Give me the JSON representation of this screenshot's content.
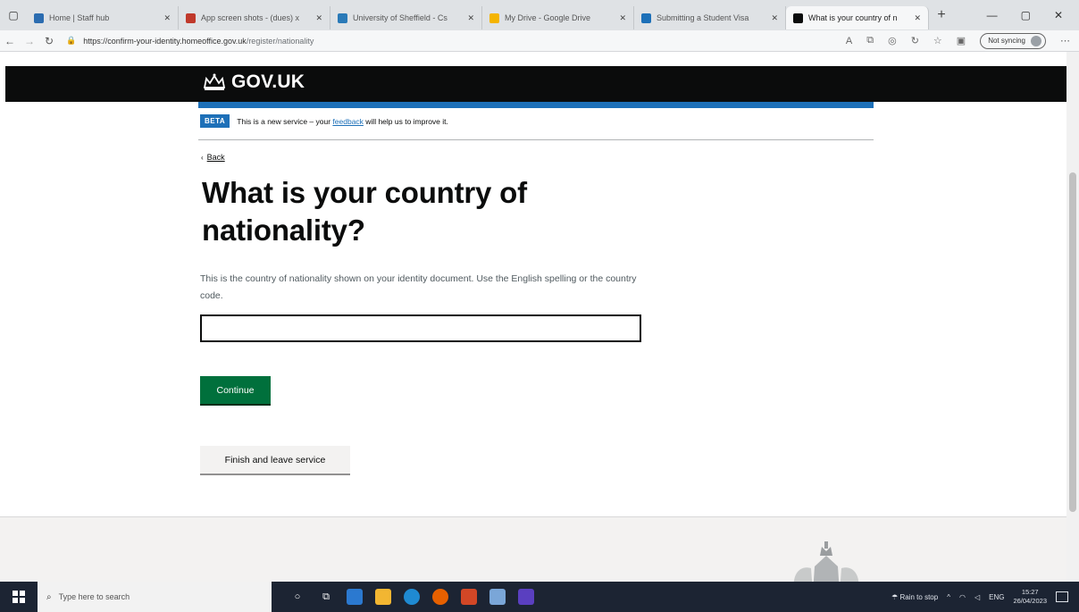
{
  "browser": {
    "tabs": [
      {
        "label": "Home | Staff hub",
        "favicon_color": "#2b6cb0",
        "active": false
      },
      {
        "label": "App screen shots - (dues) x",
        "favicon_color": "#c0392b",
        "active": false
      },
      {
        "label": "University of Sheffield - Cs",
        "favicon_color": "#2a7ab8",
        "active": false
      },
      {
        "label": "My Drive - Google Drive",
        "favicon_color": "#f4b400",
        "active": false
      },
      {
        "label": "Submitting a Student Visa",
        "favicon_color": "#1d70b8",
        "active": false
      },
      {
        "label": "What is your country of n",
        "favicon_color": "#0b0c0c",
        "active": true
      }
    ],
    "new_tab_symbol": "+",
    "url_host": "https://confirm-your-identity.homeoffice.gov.uk",
    "url_path": "/register/nationality",
    "sync_label": "Not syncing"
  },
  "header": {
    "logo_text": "GOV.UK"
  },
  "phase_banner": {
    "tag": "BETA",
    "text_before": "This is a new service – your ",
    "link_text": "feedback",
    "text_after": " will help us to improve it."
  },
  "back_link": {
    "label": "Back"
  },
  "question": {
    "heading": "What is your country of nationality?",
    "hint": "This is the country of nationality shown on your identity document. Use the English spelling or the country code.",
    "input_value": ""
  },
  "buttons": {
    "continue_label": "Continue",
    "finish_label": "Finish and leave service"
  },
  "taskbar": {
    "search_placeholder": "Type here to search",
    "weather_text": "Rain to stop",
    "lang": "ENG",
    "time": "15:27",
    "date": "26/04/2023"
  },
  "colors": {
    "govuk_blue": "#1d70b8",
    "govuk_green": "#00703c",
    "govuk_black": "#0b0c0c"
  }
}
